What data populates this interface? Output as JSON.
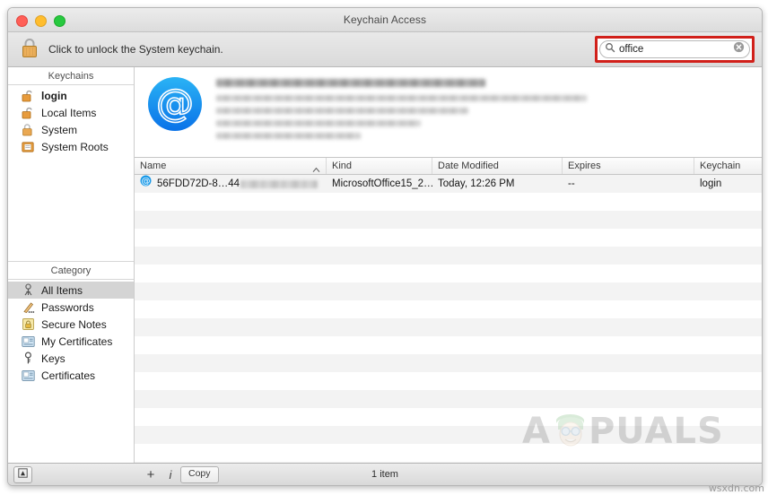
{
  "window": {
    "title": "Keychain Access",
    "traffic_lights": [
      "close-button",
      "minimize-button",
      "maximize-button"
    ]
  },
  "toolbar": {
    "lock_icon": "padlock-closed-icon",
    "unlock_message": "Click to unlock the System keychain.",
    "search": {
      "icon": "search-icon",
      "value": "office",
      "placeholder": "Search",
      "clear_icon": "clear-icon",
      "highlight_color": "#d1201a"
    }
  },
  "sidebar": {
    "keychains_header": "Keychains",
    "keychains": [
      {
        "label": "login",
        "icon": "unlocked-keychain-icon",
        "bold": true,
        "selected": false
      },
      {
        "label": "Local Items",
        "icon": "unlocked-keychain-icon",
        "bold": false,
        "selected": false
      },
      {
        "label": "System",
        "icon": "locked-keychain-icon",
        "bold": false,
        "selected": false
      },
      {
        "label": "System Roots",
        "icon": "system-roots-icon",
        "bold": false,
        "selected": false
      }
    ],
    "category_header": "Category",
    "categories": [
      {
        "label": "All Items",
        "icon": "all-items-icon",
        "selected": true
      },
      {
        "label": "Passwords",
        "icon": "passwords-icon",
        "selected": false
      },
      {
        "label": "Secure Notes",
        "icon": "secure-notes-icon",
        "selected": false
      },
      {
        "label": "My Certificates",
        "icon": "my-certificates-icon",
        "selected": false
      },
      {
        "label": "Keys",
        "icon": "keys-icon",
        "selected": false
      },
      {
        "label": "Certificates",
        "icon": "certificates-icon",
        "selected": false
      }
    ]
  },
  "detail": {
    "icon": "at-sign-icon",
    "redacted_lines": 5,
    "note": "item details are blurred/redacted"
  },
  "table": {
    "columns": [
      {
        "label": "Name",
        "sorted": "ascending",
        "sort_icon": "caret-up-icon"
      },
      {
        "label": "Kind",
        "sorted": "none"
      },
      {
        "label": "Date Modified",
        "sorted": "none"
      },
      {
        "label": "Expires",
        "sorted": "none"
      },
      {
        "label": "Keychain",
        "sorted": "none"
      }
    ],
    "rows": [
      {
        "icon": "at-sign-icon",
        "name": "56FDD72D-8…44",
        "name_redacted": true,
        "kind": "MicrosoftOffice15_2…",
        "date_modified": "Today, 12:26 PM",
        "expires": "--",
        "keychain": "login"
      }
    ]
  },
  "watermarks": {
    "center": "PUALS",
    "center_prefix": "A",
    "bottom_right": "wsxdn.com"
  },
  "bottombar": {
    "toggle_detail_icon": "show-info-icon",
    "add_label": "+",
    "info_label": "i",
    "copy_label": "Copy",
    "status": "1 item"
  }
}
